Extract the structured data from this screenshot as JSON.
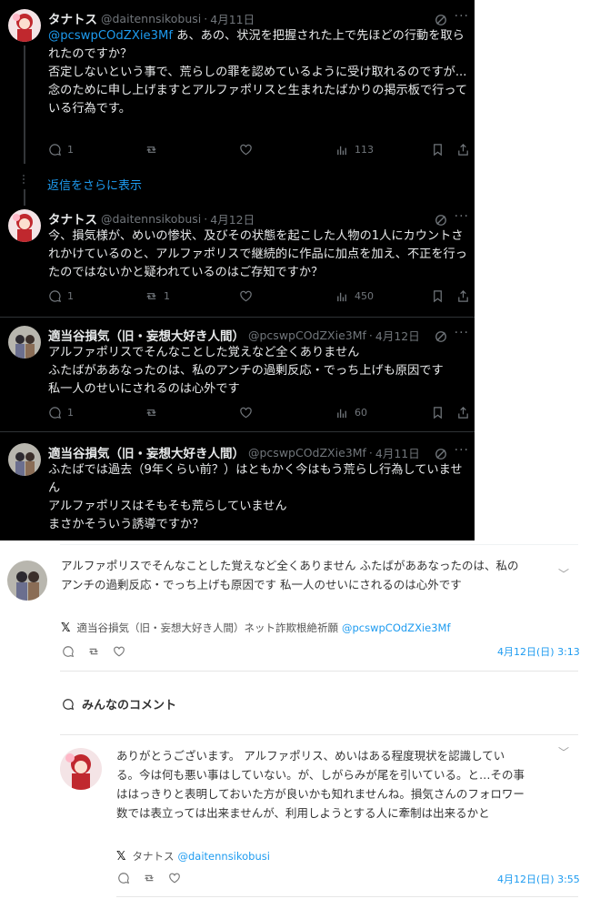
{
  "tweets": [
    {
      "name": "タナトス",
      "handle": "@daitennsikobusi",
      "date": "4月11日",
      "mention": "@pcswpCOdZXie3Mf",
      "text": " あ、あの、状況を把握された上で先ほどの行動を取られたのですか？\n否定しないという事で、荒らしの罪を認めているように受け取れるのですが...\n念のために申し上げますとアルファポリスと生まれたばかりの掲示板で行っている行為です。",
      "replies": "1",
      "retweets": "",
      "likes": "",
      "views": "113"
    },
    {
      "name": "タナトス",
      "handle": "@daitennsikobusi",
      "date": "4月12日",
      "text": "今、損気様が、めいの惨状、及びその状態を起こした人物の1人にカウントされかけているのと、アルファポリスで継続的に作品に加点を加え、不正を行ったのではないかと疑われているのはご存知ですか？",
      "replies": "1",
      "retweets": "1",
      "likes": "",
      "views": "450"
    },
    {
      "name": "適当谷損気（旧・妄想大好き人間）",
      "handle": "@pcswpCOdZXie3Mf",
      "date": "4月12日",
      "text": "アルファポリスでそんなことした覚えなど全くありません\nふたばがああなったのは、私のアンチの過剰反応・でっち上げも原因です\n私一人のせいにされるのは心外です",
      "replies": "1",
      "retweets": "",
      "likes": "",
      "views": "60"
    },
    {
      "name": "適当谷損気（旧・妄想大好き人間）",
      "handle": "@pcswpCOdZXie3Mf",
      "date": "4月11日",
      "text": "ふたばでは過去（9年くらい前？）はともかく今はもう荒らし行為していません\nアルファポリスはそもそも荒らしていません\nまさかそういう誘導ですか？"
    }
  ],
  "show_more": "返信をさらに表示",
  "quote_comment": {
    "text": "アルファポリスでそんなことした覚えなど全くありません ふたばがああなったのは、私のアンチの過剰反応・でっち上げも原因です 私一人のせいにされるのは心外です",
    "x_mark": "𝕏",
    "author": "適当谷損気（旧・妄想大好き人間）ネット詐欺根絶祈願",
    "handle": "@pcswpCOdZXie3Mf",
    "date": "4月12日(日) 3:13"
  },
  "section_title": "みんなのコメント",
  "reply_comment": {
    "text": "ありがとうございます。 アルファポリス、めいはある程度現状を認識している。今は何も悪い事はしていない。が、しがらみが尾を引いている。と…その事ははっきりと表明しておいた方が良いかも知れませんね。損気さんのフォロワー数では表立っては出来ませんが、利用しようとする人に牽制は出来るかと",
    "x_mark": "𝕏",
    "author": "タナトス",
    "handle": "@daitennsikobusi",
    "date": "4月12日(日) 3:55"
  },
  "colors": {
    "link": "#1d9bf0",
    "dark_bg": "#000000",
    "muted": "#71767b"
  }
}
